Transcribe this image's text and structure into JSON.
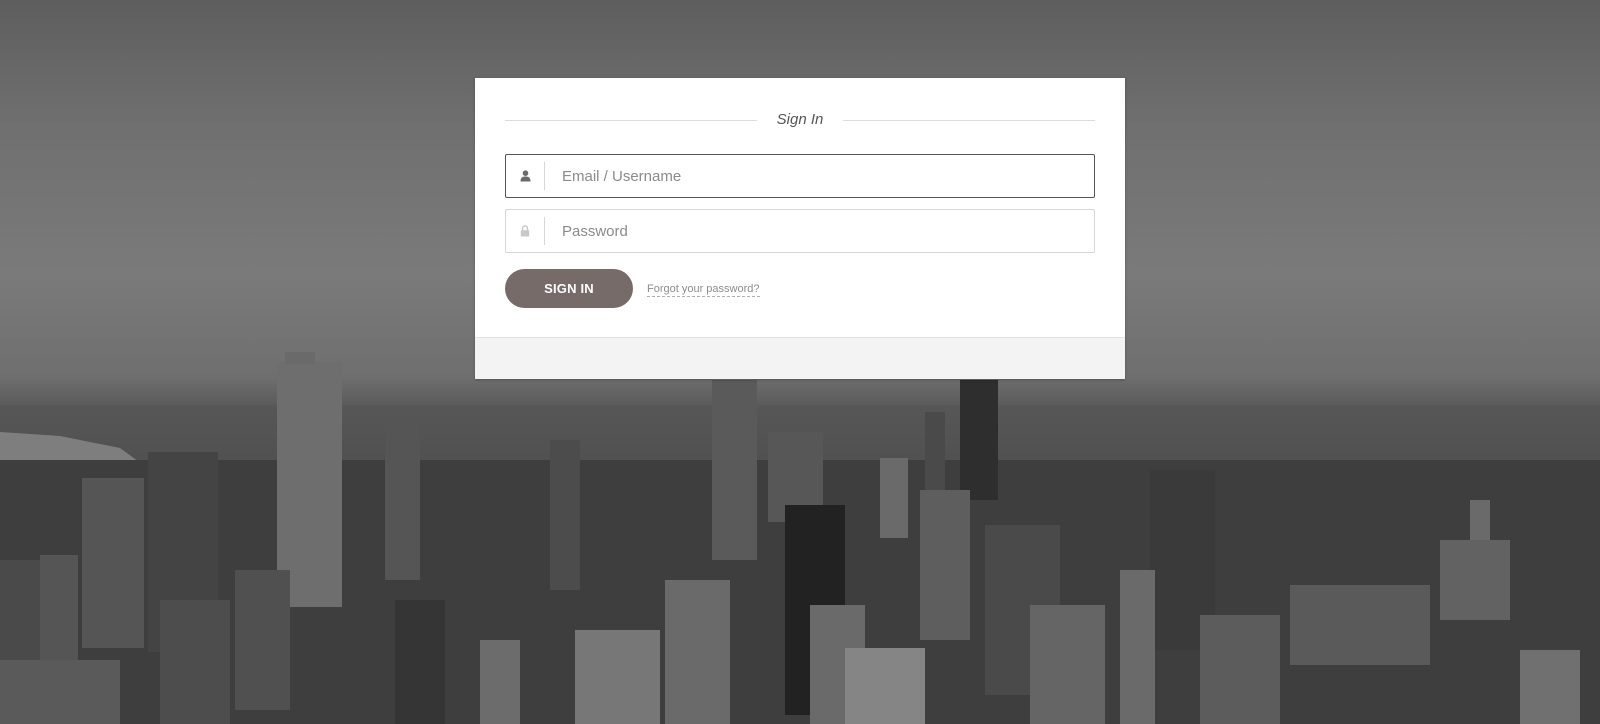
{
  "background": {
    "description_icon": "city-skyline-background"
  },
  "login": {
    "title": "Sign In",
    "email_field": {
      "placeholder": "Email / Username",
      "value": "",
      "icon": "user-icon"
    },
    "password_field": {
      "placeholder": "Password",
      "value": "",
      "icon": "lock-icon"
    },
    "signin_label": "SIGN IN",
    "forgot_label": "Forgot your password?"
  },
  "colors": {
    "button": "#766b69",
    "focused_border": "#555555",
    "footer": "#f3f3f3"
  }
}
